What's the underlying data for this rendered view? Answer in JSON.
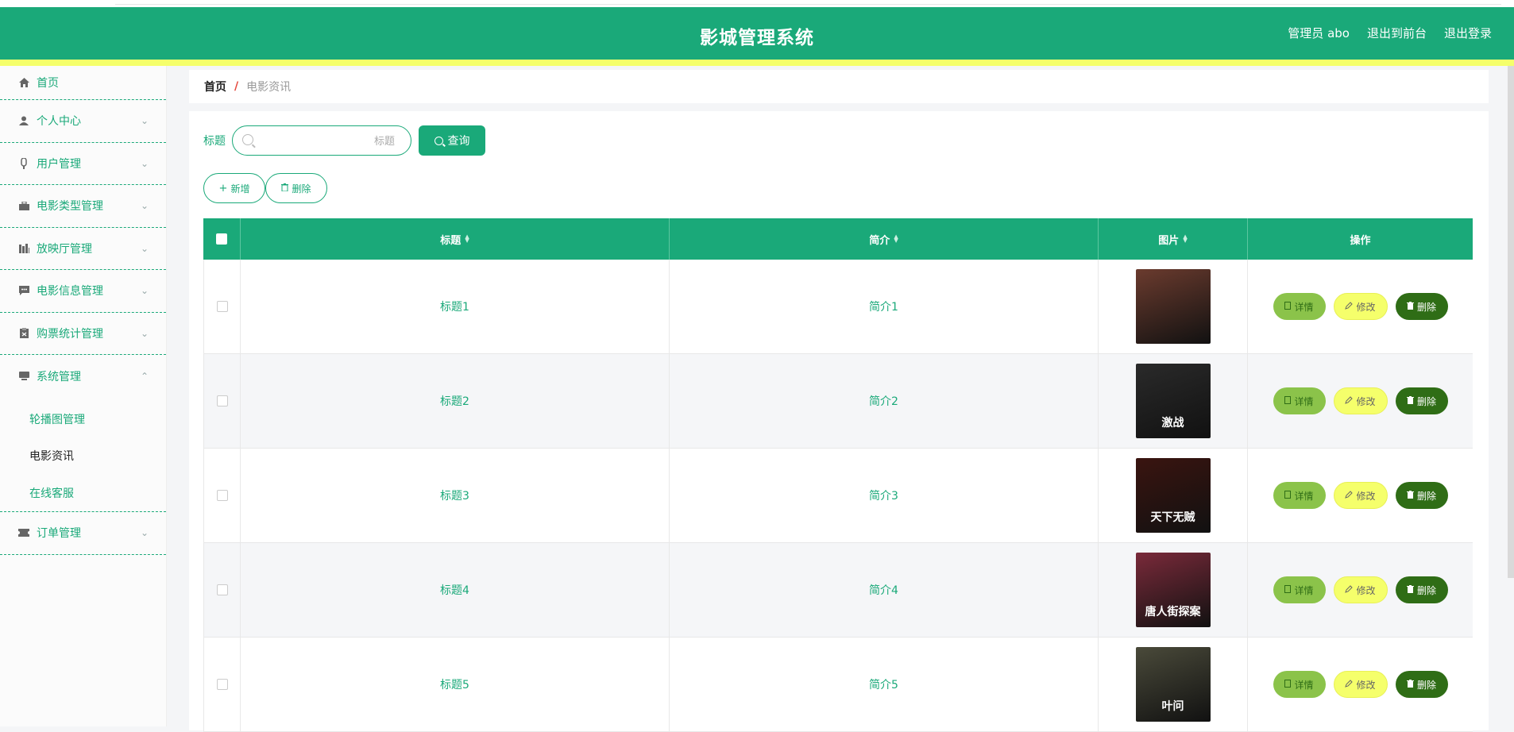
{
  "header": {
    "title": "影城管理系统",
    "admin": "管理员 abo",
    "to_front": "退出到前台",
    "logout": "退出登录"
  },
  "sidebar": {
    "items": [
      {
        "label": "首页",
        "icon": "home-icon"
      },
      {
        "label": "个人中心",
        "icon": "person-icon"
      },
      {
        "label": "用户管理",
        "icon": "user-manage-icon"
      },
      {
        "label": "电影类型管理",
        "icon": "briefcase-icon"
      },
      {
        "label": "放映厅管理",
        "icon": "building-icon"
      },
      {
        "label": "电影信息管理",
        "icon": "chat-icon"
      },
      {
        "label": "购票统计管理",
        "icon": "clipboard-icon"
      },
      {
        "label": "系统管理",
        "icon": "system-icon"
      },
      {
        "label": "订单管理",
        "icon": "ticket-icon"
      }
    ],
    "system_sub": [
      {
        "label": "轮播图管理"
      },
      {
        "label": "电影资讯"
      },
      {
        "label": "在线客服"
      }
    ]
  },
  "breadcrumb": {
    "home": "首页",
    "sep": "/",
    "current": "电影资讯"
  },
  "search": {
    "label": "标题",
    "placeholder": "标题",
    "button": "查询"
  },
  "actions": {
    "add": "新增",
    "delete": "删除"
  },
  "table": {
    "headers": {
      "title": "标题",
      "intro": "简介",
      "image": "图片",
      "ops": "操作"
    },
    "rows": [
      {
        "title": "标题1",
        "intro": "简介1",
        "poster_color": "#6b3b2e",
        "poster_text": ""
      },
      {
        "title": "标题2",
        "intro": "简介2",
        "poster_color": "#2a2a2a",
        "poster_text": "激战"
      },
      {
        "title": "标题3",
        "intro": "简介3",
        "poster_color": "#3a1410",
        "poster_text": "天下无贼"
      },
      {
        "title": "标题4",
        "intro": "简介4",
        "poster_color": "#7a2a3a",
        "poster_text": "唐人街探案"
      },
      {
        "title": "标题5",
        "intro": "简介5",
        "poster_color": "#4a4a3a",
        "poster_text": "叶问"
      }
    ],
    "ops": {
      "detail": "详情",
      "edit": "修改",
      "delete": "删除"
    }
  },
  "colors": {
    "primary": "#1aa979",
    "accent_yellow": "#f5ff6b",
    "detail": "#8bc34a",
    "danger": "#2f6d16"
  }
}
